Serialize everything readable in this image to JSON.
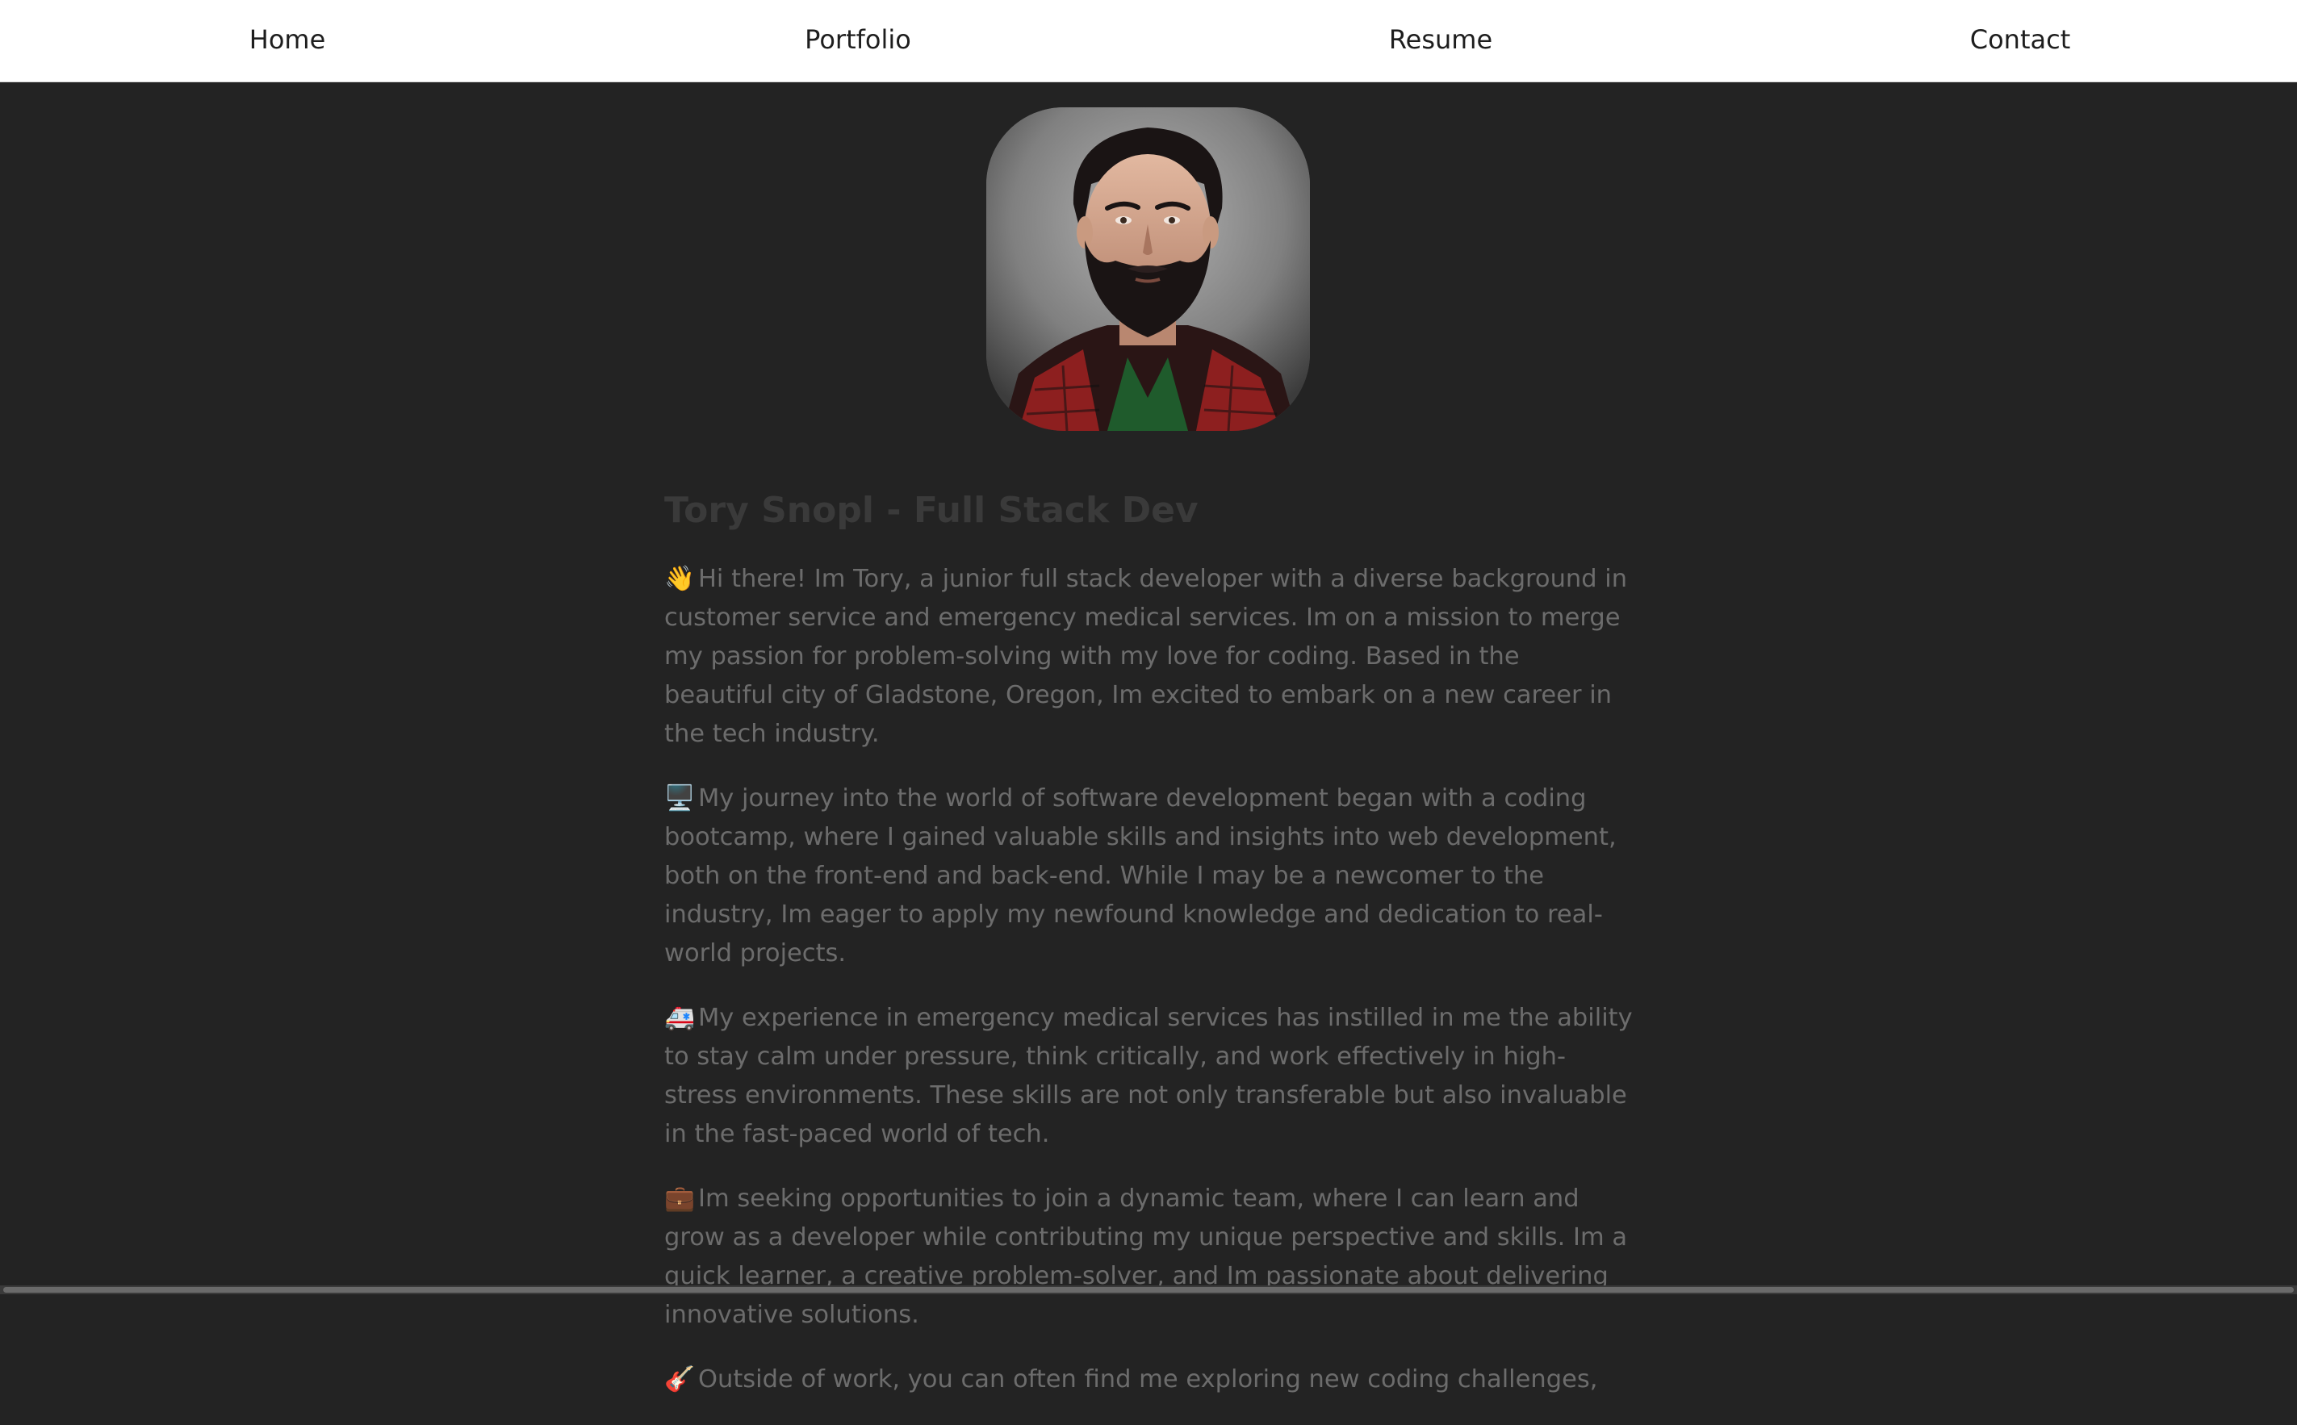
{
  "nav": {
    "home": "Home",
    "portfolio": "Portfolio",
    "resume": "Resume",
    "contact": "Contact"
  },
  "profile": {
    "heading": "Tory Snopl - Full Stack Dev"
  },
  "paragraphs": [
    {
      "icon": "waving-hand-icon",
      "emoji": "👋",
      "text": "Hi there! Im Tory, a junior full stack developer with a diverse background in customer service and emergency medical services. Im on a mission to merge my passion for problem-solving with my love for coding. Based in the beautiful city of Gladstone, Oregon, Im excited to embark on a new career in the tech industry."
    },
    {
      "icon": "desktop-computer-icon",
      "emoji": "🖥️",
      "text": "My journey into the world of software development began with a coding bootcamp, where I gained valuable skills and insights into web development, both on the front-end and back-end. While I may be a newcomer to the industry, Im eager to apply my newfound knowledge and dedication to real-world projects."
    },
    {
      "icon": "ambulance-icon",
      "emoji": "🚑",
      "text": "My experience in emergency medical services has instilled in me the ability to stay calm under pressure, think critically, and work effectively in high-stress environments. These skills are not only transferable but also invaluable in the fast-paced world of tech."
    },
    {
      "icon": "briefcase-icon",
      "emoji": "💼",
      "text": "Im seeking opportunities to join a dynamic team, where I can learn and grow as a developer while contributing my unique perspective and skills. Im a quick learner, a creative problem-solver, and Im passionate about delivering innovative solutions."
    },
    {
      "icon": "guitar-icon",
      "emoji": "🎸",
      "text": "Outside of work, you can often find me exploring new coding challenges,"
    }
  ]
}
